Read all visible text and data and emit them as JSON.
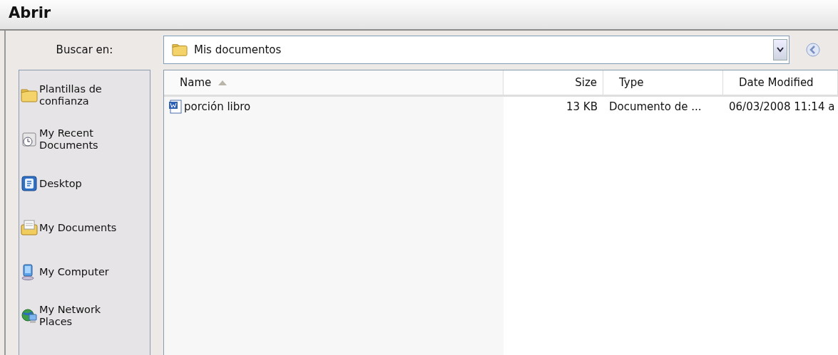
{
  "window": {
    "title": "Abrir"
  },
  "look_in": {
    "label": "Buscar en:",
    "value": "Mis documentos"
  },
  "sidebar": {
    "items": [
      {
        "label": "Plantillas de confianza",
        "kind": "folder"
      },
      {
        "label": "My Recent Documents",
        "kind": "recent"
      },
      {
        "label": "Desktop",
        "kind": "desktop"
      },
      {
        "label": "My Documents",
        "kind": "documents"
      },
      {
        "label": "My Computer",
        "kind": "computer"
      },
      {
        "label": "My Network Places",
        "kind": "network"
      }
    ]
  },
  "table": {
    "columns": [
      {
        "label": "Name",
        "sorted": true
      },
      {
        "label": "Size",
        "sorted": false
      },
      {
        "label": "Type",
        "sorted": false
      },
      {
        "label": "Date Modified",
        "sorted": false
      }
    ],
    "rows": [
      {
        "name": "porción libro",
        "size": "13 KB",
        "type": "Documento de ...",
        "date": "06/03/2008 11:14 a"
      }
    ]
  }
}
